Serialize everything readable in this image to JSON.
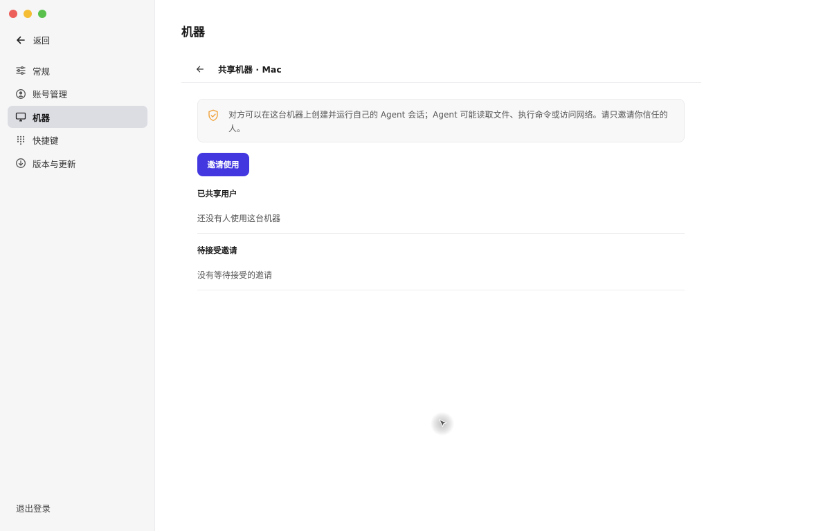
{
  "sidebar": {
    "back_label": "返回",
    "items": [
      {
        "label": "常规",
        "icon": "sliders-icon",
        "active": false
      },
      {
        "label": "账号管理",
        "icon": "user-circle-icon",
        "active": false
      },
      {
        "label": "机器",
        "icon": "monitor-icon",
        "active": true
      },
      {
        "label": "快捷键",
        "icon": "keypad-icon",
        "active": false
      },
      {
        "label": "版本与更新",
        "icon": "download-circle-icon",
        "active": false
      }
    ],
    "logout_label": "退出登录"
  },
  "main": {
    "title": "机器",
    "subheader_title": "共享机器 · Mac",
    "notice": {
      "icon": "shield-check-icon",
      "text": "对方可以在这台机器上创建并运行自己的 Agent 会话；Agent 可能读取文件、执行命令或访问网络。请只邀请你信任的人。"
    },
    "invite_button": "邀请使用",
    "shared_users": {
      "heading": "已共享用户",
      "empty": "还没有人使用这台机器"
    },
    "pending_invites": {
      "heading": "待接受邀请",
      "empty": "没有等待接受的邀请"
    }
  },
  "colors": {
    "accent": "#4338e0",
    "active_bg": "#dcdde3",
    "sidebar_bg": "#f6f6f7",
    "shield": "#f0a33c"
  }
}
